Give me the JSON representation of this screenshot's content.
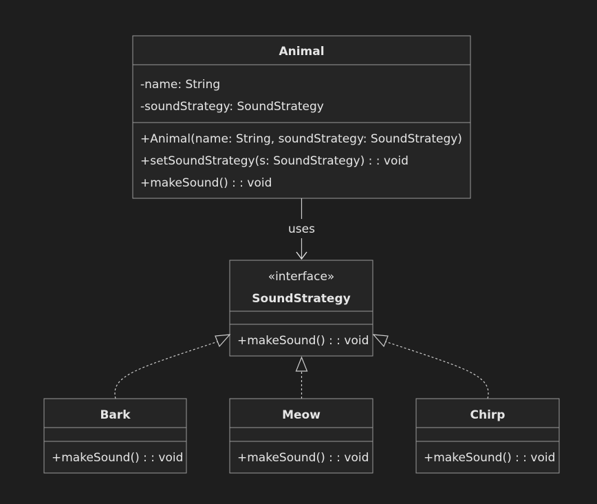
{
  "classes": {
    "animal": {
      "name": "Animal",
      "attributes": [
        "-name: String",
        "-soundStrategy: SoundStrategy"
      ],
      "methods": [
        "+Animal(name: String, soundStrategy: SoundStrategy)",
        "+setSoundStrategy(s: SoundStrategy) : : void",
        "+makeSound() : : void"
      ]
    },
    "sound_strategy": {
      "stereotype": "«interface»",
      "name": "SoundStrategy",
      "methods": [
        "+makeSound() : : void"
      ]
    },
    "bark": {
      "name": "Bark",
      "methods": [
        "+makeSound() : : void"
      ]
    },
    "meow": {
      "name": "Meow",
      "methods": [
        "+makeSound() : : void"
      ]
    },
    "chirp": {
      "name": "Chirp",
      "methods": [
        "+makeSound() : : void"
      ]
    }
  },
  "relations": {
    "uses_label": "uses"
  }
}
